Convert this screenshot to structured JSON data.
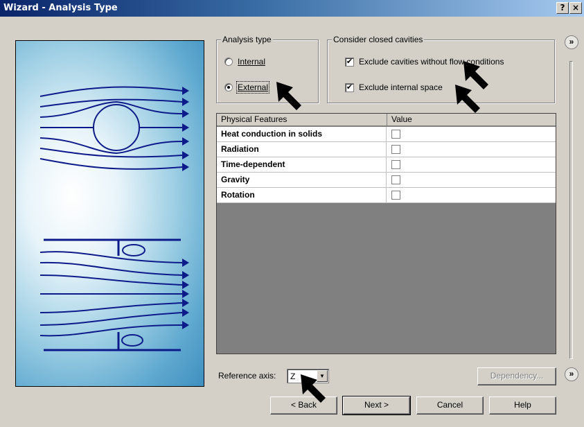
{
  "window": {
    "title": "Wizard - Analysis Type",
    "help_btn": "?",
    "close_btn": "×"
  },
  "analysis_type": {
    "legend": "Analysis type",
    "options": [
      {
        "label": "Internal",
        "selected": false
      },
      {
        "label": "External",
        "selected": true
      }
    ]
  },
  "cavities": {
    "legend": "Consider closed cavities",
    "options": [
      {
        "label": "Exclude cavities without flow conditions",
        "checked": true
      },
      {
        "label": "Exclude internal space",
        "checked": true
      }
    ]
  },
  "features_table": {
    "columns": [
      "Physical Features",
      "Value"
    ],
    "rows": [
      {
        "name": "Heat conduction in solids",
        "checked": false
      },
      {
        "name": "Radiation",
        "checked": false
      },
      {
        "name": "Time-dependent",
        "checked": false
      },
      {
        "name": "Gravity",
        "checked": false
      },
      {
        "name": "Rotation",
        "checked": false
      }
    ]
  },
  "reference_axis": {
    "label": "Reference axis:",
    "value": "Z"
  },
  "buttons": {
    "dependency": "Dependency...",
    "back": "< Back",
    "next": "Next >",
    "cancel": "Cancel",
    "help": "Help"
  },
  "side": {
    "expand_top": "»",
    "expand_bottom": "»"
  },
  "checkmark": "✔",
  "colors": {
    "title_gradient_start": "#0a246a",
    "dialog_bg": "#d4d0c8",
    "grid_empty": "#808080",
    "banner_lines": "#0d1a8a"
  }
}
